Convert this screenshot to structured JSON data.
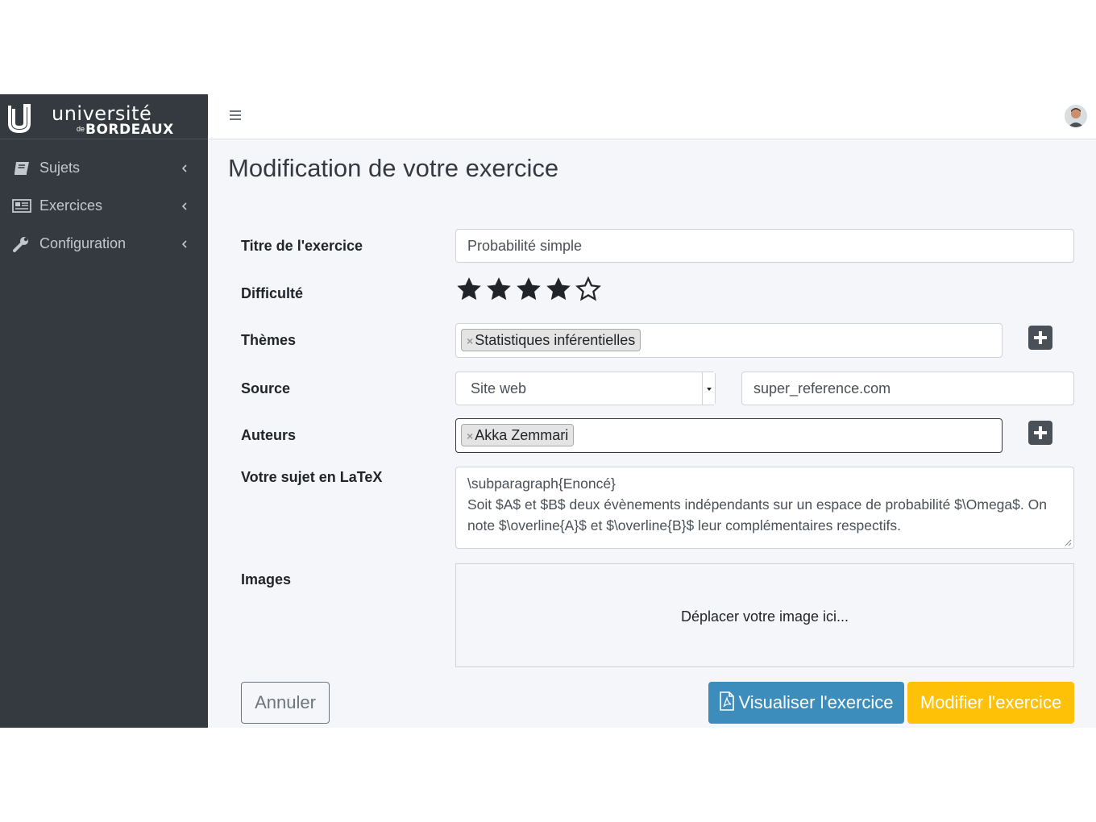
{
  "brand": {
    "line1": "université",
    "line2_prefix": "de",
    "line2": "BORDEAUX"
  },
  "sidebar": {
    "items": [
      {
        "label": "Sujets",
        "icon": "book-icon"
      },
      {
        "label": "Exercices",
        "icon": "newspaper-icon"
      },
      {
        "label": "Configuration",
        "icon": "wrench-icon"
      }
    ]
  },
  "page": {
    "title": "Modification de votre exercice"
  },
  "form": {
    "title_label": "Titre de l'exercice",
    "title_value": "Probabilité simple",
    "difficulty_label": "Difficulté",
    "difficulty_rating": 4,
    "difficulty_max": 5,
    "themes_label": "Thèmes",
    "themes_tags": [
      "Statistiques inférentielles"
    ],
    "source_label": "Source",
    "source_type": "Site web",
    "source_value": "super_reference.com",
    "authors_label": "Auteurs",
    "authors_tags": [
      "Akka Zemmari"
    ],
    "latex_label": "Votre sujet en LaTeX",
    "latex_lines": [
      "\\subparagraph{Enoncé}",
      "Soit $A$ et $B$ deux évènements indépendants sur un espace de probabilité $\\Omega$. On",
      "note $\\overline{A}$ et $\\overline{B}$ leur complémentaires respectifs."
    ],
    "images_label": "Images",
    "dropzone_text": "Déplacer votre image ici...",
    "tag_remove": "×"
  },
  "buttons": {
    "cancel": "Annuler",
    "preview": "Visualiser l'exercice",
    "submit": "Modifier l'exercice"
  },
  "colors": {
    "sidebar": "#343a40",
    "primary": "#3c8dbc",
    "warning": "#ffc107"
  }
}
